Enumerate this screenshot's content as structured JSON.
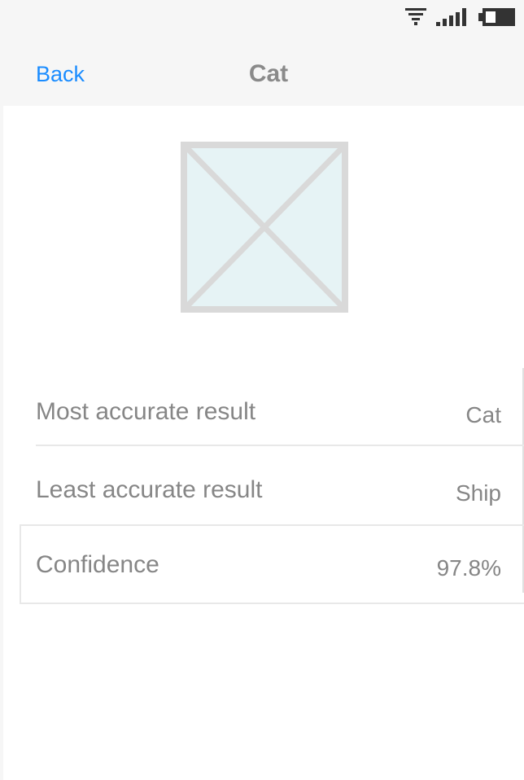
{
  "status_bar": {
    "icons": [
      "wifi-icon",
      "signal-icon",
      "battery-icon"
    ]
  },
  "nav": {
    "back_label": "Back",
    "title": "Cat"
  },
  "image": {
    "icon": "image-placeholder-icon"
  },
  "results": [
    {
      "label": "Most accurate result",
      "value": "Cat"
    },
    {
      "label": "Least accurate result",
      "value": "Ship"
    },
    {
      "label": "Confidence",
      "value": "97.8%"
    }
  ],
  "colors": {
    "accent": "#1a8cff",
    "text": "#868686",
    "background": "#f6f6f6",
    "placeholder_fill": "#e6f3f5",
    "placeholder_stroke": "#d9d9d9"
  }
}
